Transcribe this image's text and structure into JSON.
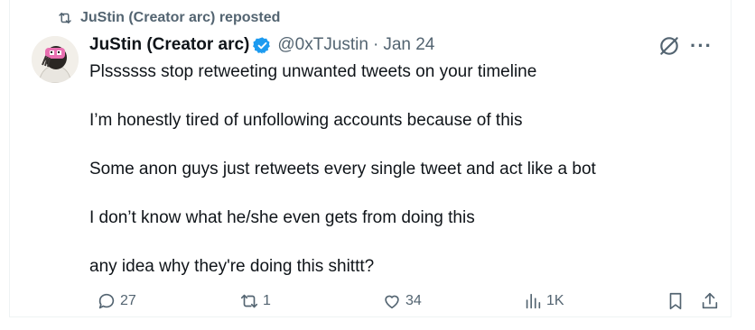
{
  "repost": {
    "text": "JuStin (Creator arc) reposted",
    "icon": "repost-icon"
  },
  "author": {
    "name": "JuStin (Creator arc)",
    "handle": "@0xTJustin",
    "separator": "·",
    "date": "Jan 24",
    "verified_color": "#1d9bf0"
  },
  "tweet": {
    "lines": [
      "Plssssss stop retweeting unwanted tweets on your timeline",
      "I’m honestly tired of unfollowing accounts because of this",
      "Some anon guys just retweets every single tweet and act like a bot",
      "I don’t know what he/she even gets from doing this",
      "any idea why they're doing this shittt?"
    ]
  },
  "actions": {
    "replies": "27",
    "reposts": "1",
    "likes": "34",
    "views": "1K"
  },
  "icons": [
    "repost-icon",
    "verified-badge-icon",
    "grok-icon",
    "more-icon",
    "reply-icon",
    "retweet-icon",
    "like-icon",
    "views-icon",
    "bookmark-icon",
    "share-icon"
  ]
}
